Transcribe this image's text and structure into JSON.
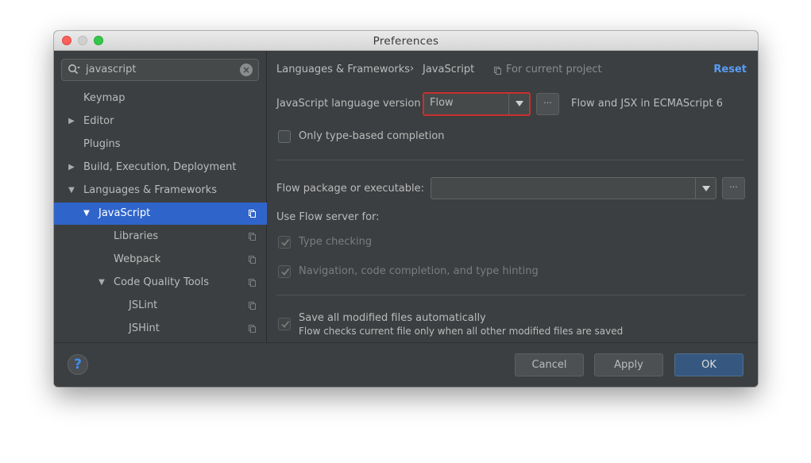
{
  "window": {
    "title": "Preferences"
  },
  "sidebar": {
    "search": {
      "value": "javascript"
    },
    "items": [
      {
        "label": "Keymap",
        "arrow": "",
        "selected": false
      },
      {
        "label": "Editor",
        "arrow": "▶",
        "selected": false
      },
      {
        "label": "Plugins",
        "arrow": "",
        "selected": false
      },
      {
        "label": "Build, Execution, Deployment",
        "arrow": "▶",
        "selected": false
      },
      {
        "label": "Languages & Frameworks",
        "arrow": "▼",
        "selected": false
      },
      {
        "label": "JavaScript",
        "arrow": "▼",
        "selected": true
      },
      {
        "label": "Libraries",
        "arrow": "",
        "selected": false
      },
      {
        "label": "Webpack",
        "arrow": "",
        "selected": false
      },
      {
        "label": "Code Quality Tools",
        "arrow": "▼",
        "selected": false
      },
      {
        "label": "JSLint",
        "arrow": "",
        "selected": false
      },
      {
        "label": "JSHint",
        "arrow": "",
        "selected": false
      }
    ]
  },
  "content": {
    "breadcrumb": {
      "parent": "Languages & Frameworks",
      "separator": "›",
      "current": "JavaScript"
    },
    "scope": "For current project",
    "reset": "Reset",
    "js_version": {
      "label": "JavaScript language version",
      "value": "Flow",
      "more": "···",
      "description": "Flow and JSX in ECMAScript 6",
      "highlight_color": "#c8302f"
    },
    "only_type_based": {
      "label": "Only type-based completion",
      "checked": false
    },
    "flow_package": {
      "label": "Flow package or executable:",
      "value": "",
      "more": "···"
    },
    "use_flow_server": {
      "label": "Use Flow server for:",
      "type_checking": {
        "label": "Type checking",
        "checked": true,
        "enabled": false
      },
      "navigation": {
        "label": "Navigation, code completion, and type hinting",
        "checked": true,
        "enabled": false
      }
    },
    "save_all": {
      "label": "Save all modified files automatically",
      "note": "Flow checks current file only when all other modified files are saved",
      "checked": true,
      "enabled": false
    }
  },
  "footer": {
    "help": "?",
    "cancel": "Cancel",
    "apply": "Apply",
    "ok": "OK"
  },
  "colors": {
    "selection": "#2f65ca",
    "link": "#589df6",
    "ok_button": "#365880"
  }
}
